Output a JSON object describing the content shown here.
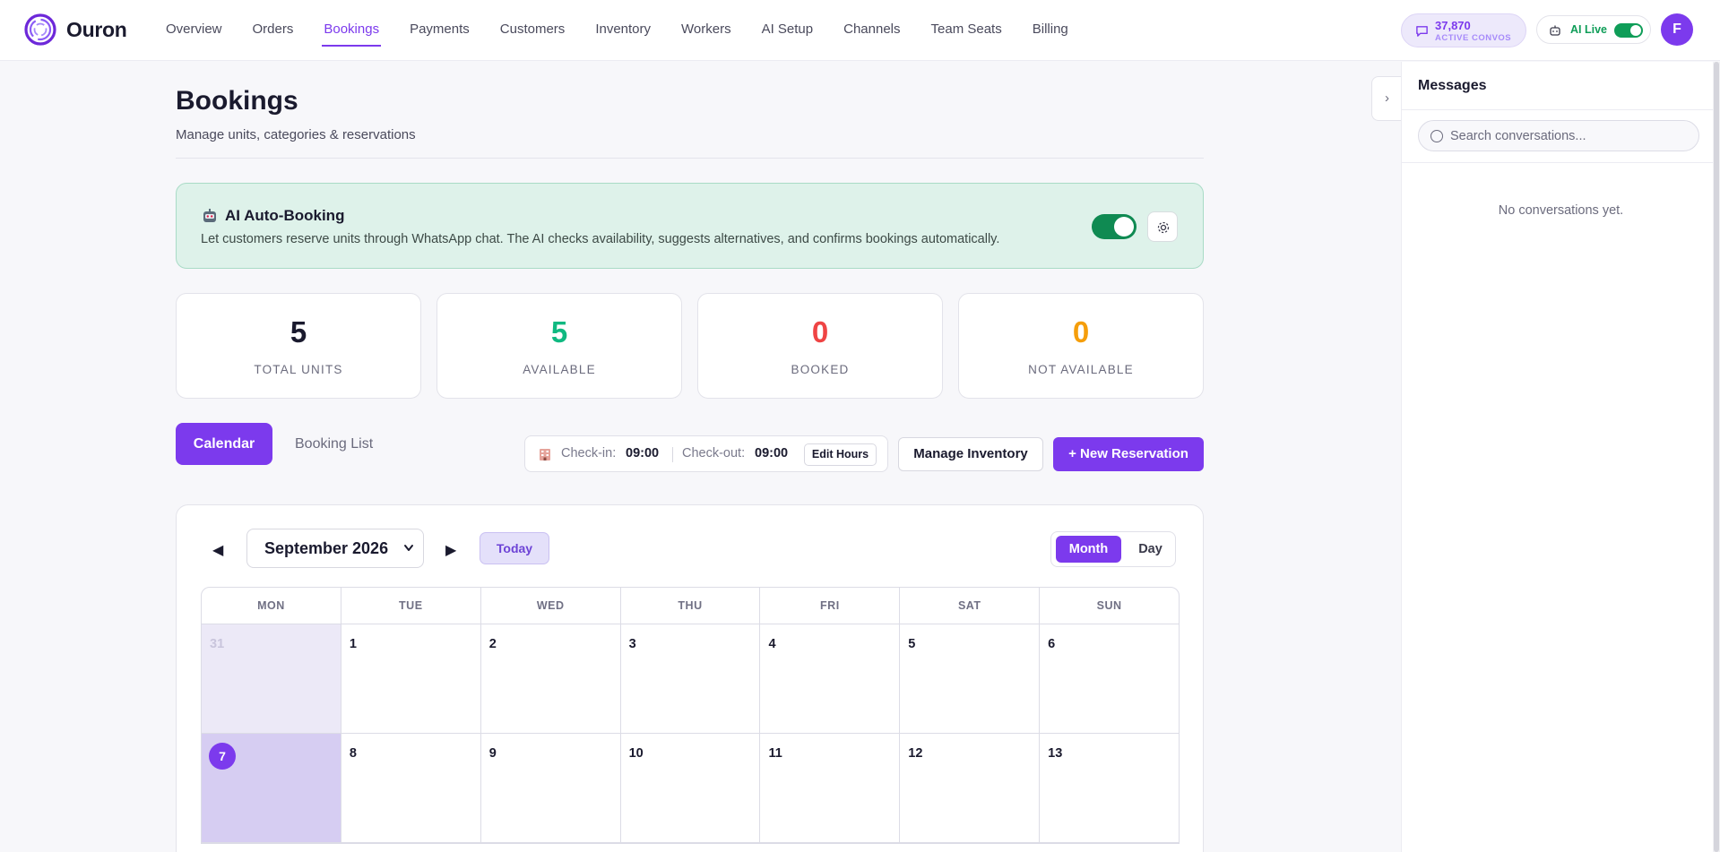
{
  "app": {
    "name": "Ouron"
  },
  "nav": {
    "items": [
      {
        "label": "Overview"
      },
      {
        "label": "Orders"
      },
      {
        "label": "Bookings",
        "active": true
      },
      {
        "label": "Payments"
      },
      {
        "label": "Customers"
      },
      {
        "label": "Inventory"
      },
      {
        "label": "Workers"
      },
      {
        "label": "AI Setup"
      },
      {
        "label": "Channels"
      },
      {
        "label": "Team Seats"
      },
      {
        "label": "Billing"
      }
    ]
  },
  "header_right": {
    "convos_count": "37,870",
    "convos_label": "ACTIVE CONVOS",
    "ai_live_label": "AI Live",
    "ai_live_on": true,
    "avatar_initial": "F"
  },
  "page": {
    "title": "Bookings",
    "subtitle": "Manage units, categories & reservations"
  },
  "ai_banner": {
    "title": "AI Auto-Booking",
    "description": "Let customers reserve units through WhatsApp chat. The AI checks availability, suggests alternatives, and confirms bookings automatically.",
    "enabled": true
  },
  "stats": [
    {
      "value": "5",
      "label": "TOTAL UNITS",
      "color": "#1a1a2e"
    },
    {
      "value": "5",
      "label": "AVAILABLE",
      "color": "#10b981"
    },
    {
      "value": "0",
      "label": "BOOKED",
      "color": "#ef4444"
    },
    {
      "value": "0",
      "label": "NOT AVAILABLE",
      "color": "#f59e0b"
    }
  ],
  "tabs": {
    "calendar": "Calendar",
    "list": "Booking List"
  },
  "hours": {
    "checkin_label": "Check-in:",
    "checkin_value": "09:00",
    "checkout_label": "Check-out:",
    "checkout_value": "09:00",
    "edit_label": "Edit Hours"
  },
  "actions": {
    "manage_inventory": "Manage Inventory",
    "new_reservation": "+ New Reservation"
  },
  "calendar": {
    "prev": "◀",
    "next": "▶",
    "month": "September 2026",
    "today_label": "Today",
    "view_month": "Month",
    "view_day": "Day",
    "weekdays": [
      "MON",
      "TUE",
      "WED",
      "THU",
      "FRI",
      "SAT",
      "SUN"
    ],
    "weeks": [
      [
        "31",
        "1",
        "2",
        "3",
        "4",
        "5",
        "6"
      ],
      [
        "7",
        "8",
        "9",
        "10",
        "11",
        "12",
        "13"
      ]
    ]
  },
  "messages": {
    "title": "Messages",
    "search_placeholder": "Search conversations...",
    "empty": "No conversations yet.",
    "collapse": "›"
  },
  "colors": {
    "accent": "#7c3aed",
    "success": "#0f9d58"
  }
}
